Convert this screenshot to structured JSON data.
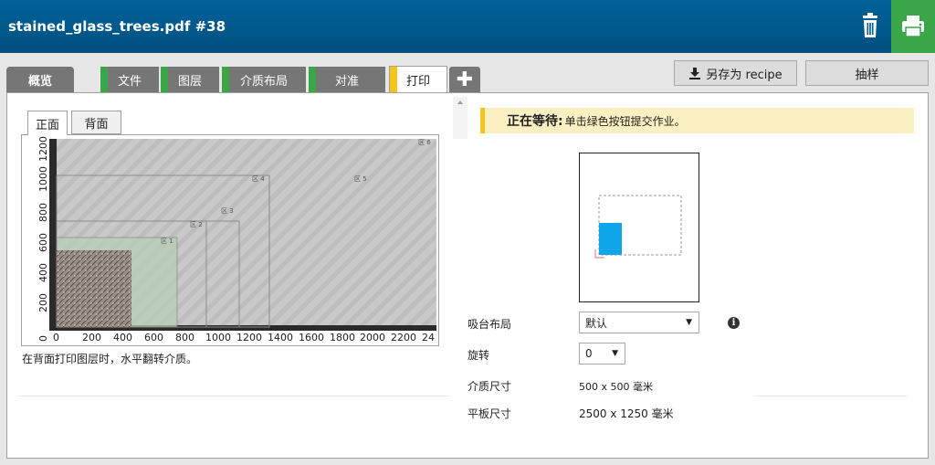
{
  "header": {
    "title": "stained_glass_trees.pdf #38"
  },
  "tabs": [
    {
      "label": "概览",
      "stripe": ""
    },
    {
      "label": "文件",
      "stripe": "#3aa648"
    },
    {
      "label": "图层",
      "stripe": "#3aa648"
    },
    {
      "label": "介质布局",
      "stripe": "#3aa648"
    },
    {
      "label": "对准",
      "stripe": "#3aa648"
    },
    {
      "label": "打印",
      "stripe": "#f5c518"
    }
  ],
  "actions": {
    "save_recipe": "另存为 recipe",
    "sample": "抽样"
  },
  "preview": {
    "front_tab": "正面",
    "back_tab": "背面",
    "y_ticks": [
      "0",
      "200",
      "400",
      "600",
      "800",
      "1000",
      "1200"
    ],
    "x_ticks": [
      "0",
      "200",
      "400",
      "600",
      "800",
      "1000",
      "1200",
      "1400",
      "1600",
      "1800",
      "2000",
      "2200",
      "24"
    ],
    "zones": [
      "区 1",
      "区 2",
      "区 3",
      "区 4",
      "区 5",
      "区 6"
    ],
    "note": "在背面打印图层时，水平翻转介质。"
  },
  "status": {
    "title": "正在等待:",
    "message": "单击绿色按钮提交作业。"
  },
  "settings": {
    "table_layout_label": "吸台布局",
    "table_layout_value": "默认",
    "rotation_label": "旋转",
    "rotation_value": "0",
    "media_size_label": "介质尺寸",
    "media_size_value": "500 x 500 毫米",
    "flatbed_size_label": "平板尺寸",
    "flatbed_size_value": "2500 x 1250 毫米"
  },
  "colors": {
    "header": "#00578c",
    "print_green": "#3aa648",
    "accent_yellow": "#f5c518",
    "media_blue": "#0ea5e9"
  }
}
